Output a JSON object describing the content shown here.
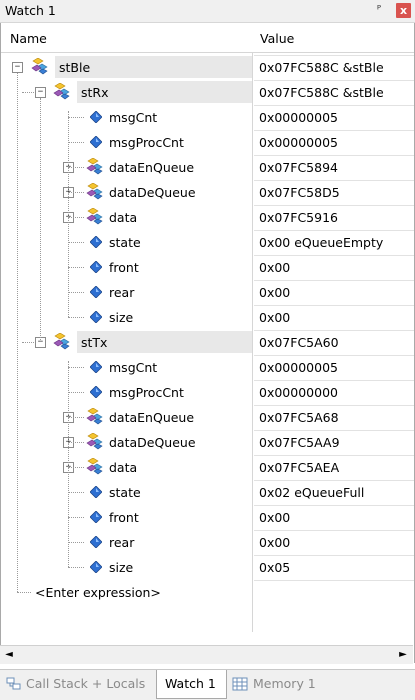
{
  "window": {
    "title": "Watch 1"
  },
  "controls": {
    "pin_icon": "pin-icon",
    "close_icon": "close-icon",
    "pin_glyph": "ᴾ",
    "close_glyph": "x"
  },
  "columns": {
    "name": "Name",
    "value": "Value"
  },
  "rows": [
    {
      "name": "stBle",
      "value": "0x07FC588C &stBle",
      "type": "struct",
      "expand": "−"
    },
    {
      "name": "stRx",
      "value": "0x07FC588C &stBle",
      "type": "struct",
      "expand": "−"
    },
    {
      "name": "msgCnt",
      "value": "0x00000005",
      "type": "field"
    },
    {
      "name": "msgProcCnt",
      "value": "0x00000005",
      "type": "field"
    },
    {
      "name": "dataEnQueue",
      "value": "0x07FC5894",
      "type": "struct",
      "expand": "+"
    },
    {
      "name": "dataDeQueue",
      "value": "0x07FC58D5",
      "type": "struct",
      "expand": "+"
    },
    {
      "name": "data",
      "value": "0x07FC5916",
      "type": "struct",
      "expand": "+"
    },
    {
      "name": "state",
      "value": "0x00 eQueueEmpty",
      "type": "field"
    },
    {
      "name": "front",
      "value": "0x00",
      "type": "field"
    },
    {
      "name": "rear",
      "value": "0x00",
      "type": "field"
    },
    {
      "name": "size",
      "value": "0x00",
      "type": "field"
    },
    {
      "name": "stTx",
      "value": "0x07FC5A60",
      "type": "struct",
      "expand": "−"
    },
    {
      "name": "msgCnt",
      "value": "0x00000005",
      "type": "field"
    },
    {
      "name": "msgProcCnt",
      "value": "0x00000000",
      "type": "field"
    },
    {
      "name": "dataEnQueue",
      "value": "0x07FC5A68",
      "type": "struct",
      "expand": "+"
    },
    {
      "name": "dataDeQueue",
      "value": "0x07FC5AA9",
      "type": "struct",
      "expand": "+"
    },
    {
      "name": "data",
      "value": "0x07FC5AEA",
      "type": "struct",
      "expand": "+"
    },
    {
      "name": "state",
      "value": "0x02 eQueueFull",
      "type": "field"
    },
    {
      "name": "front",
      "value": "0x00",
      "type": "field"
    },
    {
      "name": "rear",
      "value": "0x00",
      "type": "field"
    },
    {
      "name": "size",
      "value": "0x05",
      "type": "field"
    },
    {
      "name": "<Enter expression>",
      "value": "",
      "type": "input"
    }
  ],
  "scrollbar": {
    "left_arrow": "◄",
    "right_arrow": "►"
  },
  "tabs": [
    {
      "label": "Call Stack + Locals",
      "icon": "call-stack-icon",
      "active": false
    },
    {
      "label": "Watch 1",
      "active": true
    },
    {
      "label": "Memory 1",
      "icon": "memory-icon",
      "active": false
    }
  ]
}
